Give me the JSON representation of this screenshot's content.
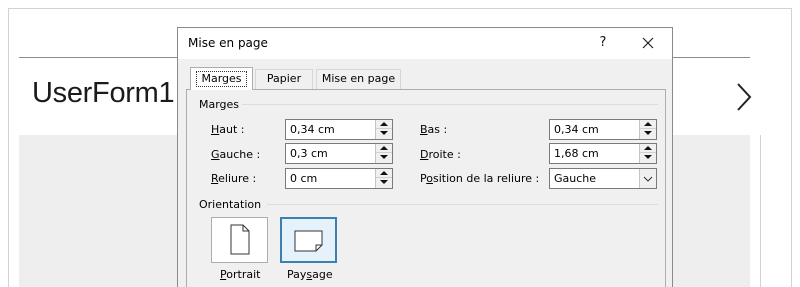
{
  "background": {
    "userform_title": "UserForm1",
    "next_icon": "chevron-right-icon"
  },
  "dialog": {
    "title": "Mise en page",
    "help_label": "?",
    "close_icon": "close-icon",
    "tabs": [
      {
        "label": "Marges",
        "active": true
      },
      {
        "label": "Papier",
        "active": false
      },
      {
        "label": "Mise en page",
        "active": false
      }
    ],
    "margins": {
      "group_label": "Marges",
      "haut": {
        "label_first": "H",
        "label_rest": "aut :",
        "value": "0,34 cm"
      },
      "gauche": {
        "label_first": "G",
        "label_rest": "auche :",
        "value": "0,3 cm"
      },
      "reliure": {
        "label_first": "R",
        "label_rest": "eliure :",
        "value": "0 cm"
      },
      "bas": {
        "label_first": "B",
        "label_rest": "as :",
        "value": "0,34 cm"
      },
      "droite": {
        "label_first": "D",
        "label_rest": "roite :",
        "value": "1,68 cm"
      },
      "position_reliure": {
        "label_pre": "P",
        "label_u": "o",
        "label_rest": "sition de la reliure :",
        "value": "Gauche"
      }
    },
    "orientation": {
      "group_label": "Orientation",
      "portrait": {
        "label_u": "P",
        "label_rest": "ortrait",
        "icon": "portrait-page-icon"
      },
      "paysage": {
        "label_pre": "Pay",
        "label_u": "s",
        "label_rest": "age",
        "icon": "landscape-page-icon",
        "selected": true
      }
    }
  },
  "colors": {
    "selected_border": "#3c7fb1",
    "selected_fill": "#e5f1fb",
    "dialog_bg": "#f0f0f0"
  }
}
